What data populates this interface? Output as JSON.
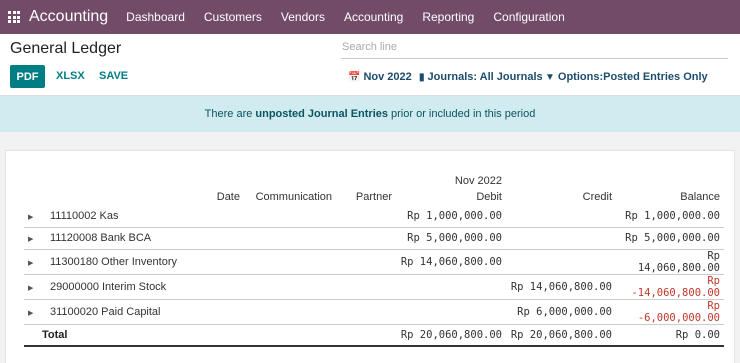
{
  "navbar": {
    "brand": "Accounting",
    "items": [
      "Dashboard",
      "Customers",
      "Vendors",
      "Accounting",
      "Reporting",
      "Configuration"
    ]
  },
  "control": {
    "title": "General Ledger",
    "search_placeholder": "Search line",
    "pdf": "PDF",
    "xlsx": "XLSX",
    "save": "SAVE",
    "period_filter": "Nov 2022",
    "journals_filter": "Journals: All Journals",
    "options_filter": "Options:Posted Entries Only"
  },
  "alert": {
    "prefix": "There are",
    "bold": "unposted Journal Entries",
    "suffix": "prior or included in this period"
  },
  "report": {
    "period_header": "Nov 2022",
    "columns": {
      "date": "Date",
      "communication": "Communication",
      "partner": "Partner",
      "debit": "Debit",
      "credit": "Credit",
      "balance": "Balance"
    },
    "rows": [
      {
        "account": "11110002 Kas",
        "debit": "Rp 1,000,000.00",
        "credit": "",
        "balance": "Rp 1,000,000.00",
        "negative": false
      },
      {
        "account": "11120008 Bank BCA",
        "debit": "Rp 5,000,000.00",
        "credit": "",
        "balance": "Rp 5,000,000.00",
        "negative": false
      },
      {
        "account": "11300180 Other Inventory",
        "debit": "Rp 14,060,800.00",
        "credit": "",
        "balance": "Rp 14,060,800.00",
        "negative": false
      },
      {
        "account": "29000000 Interim Stock",
        "debit": "",
        "credit": "Rp 14,060,800.00",
        "balance": "Rp -14,060,800.00",
        "negative": true
      },
      {
        "account": "31100020 Paid Capital",
        "debit": "",
        "credit": "Rp 6,000,000.00",
        "balance": "Rp -6,000,000.00",
        "negative": true
      }
    ],
    "total": {
      "label": "Total",
      "debit": "Rp 20,060,800.00",
      "credit": "Rp 20,060,800.00",
      "balance": "Rp 0.00"
    },
    "negative_color": "#c0392b"
  },
  "colors": {
    "navbar": "#714b67",
    "primary": "#017e84",
    "alert_bg": "#d1ecf1"
  }
}
